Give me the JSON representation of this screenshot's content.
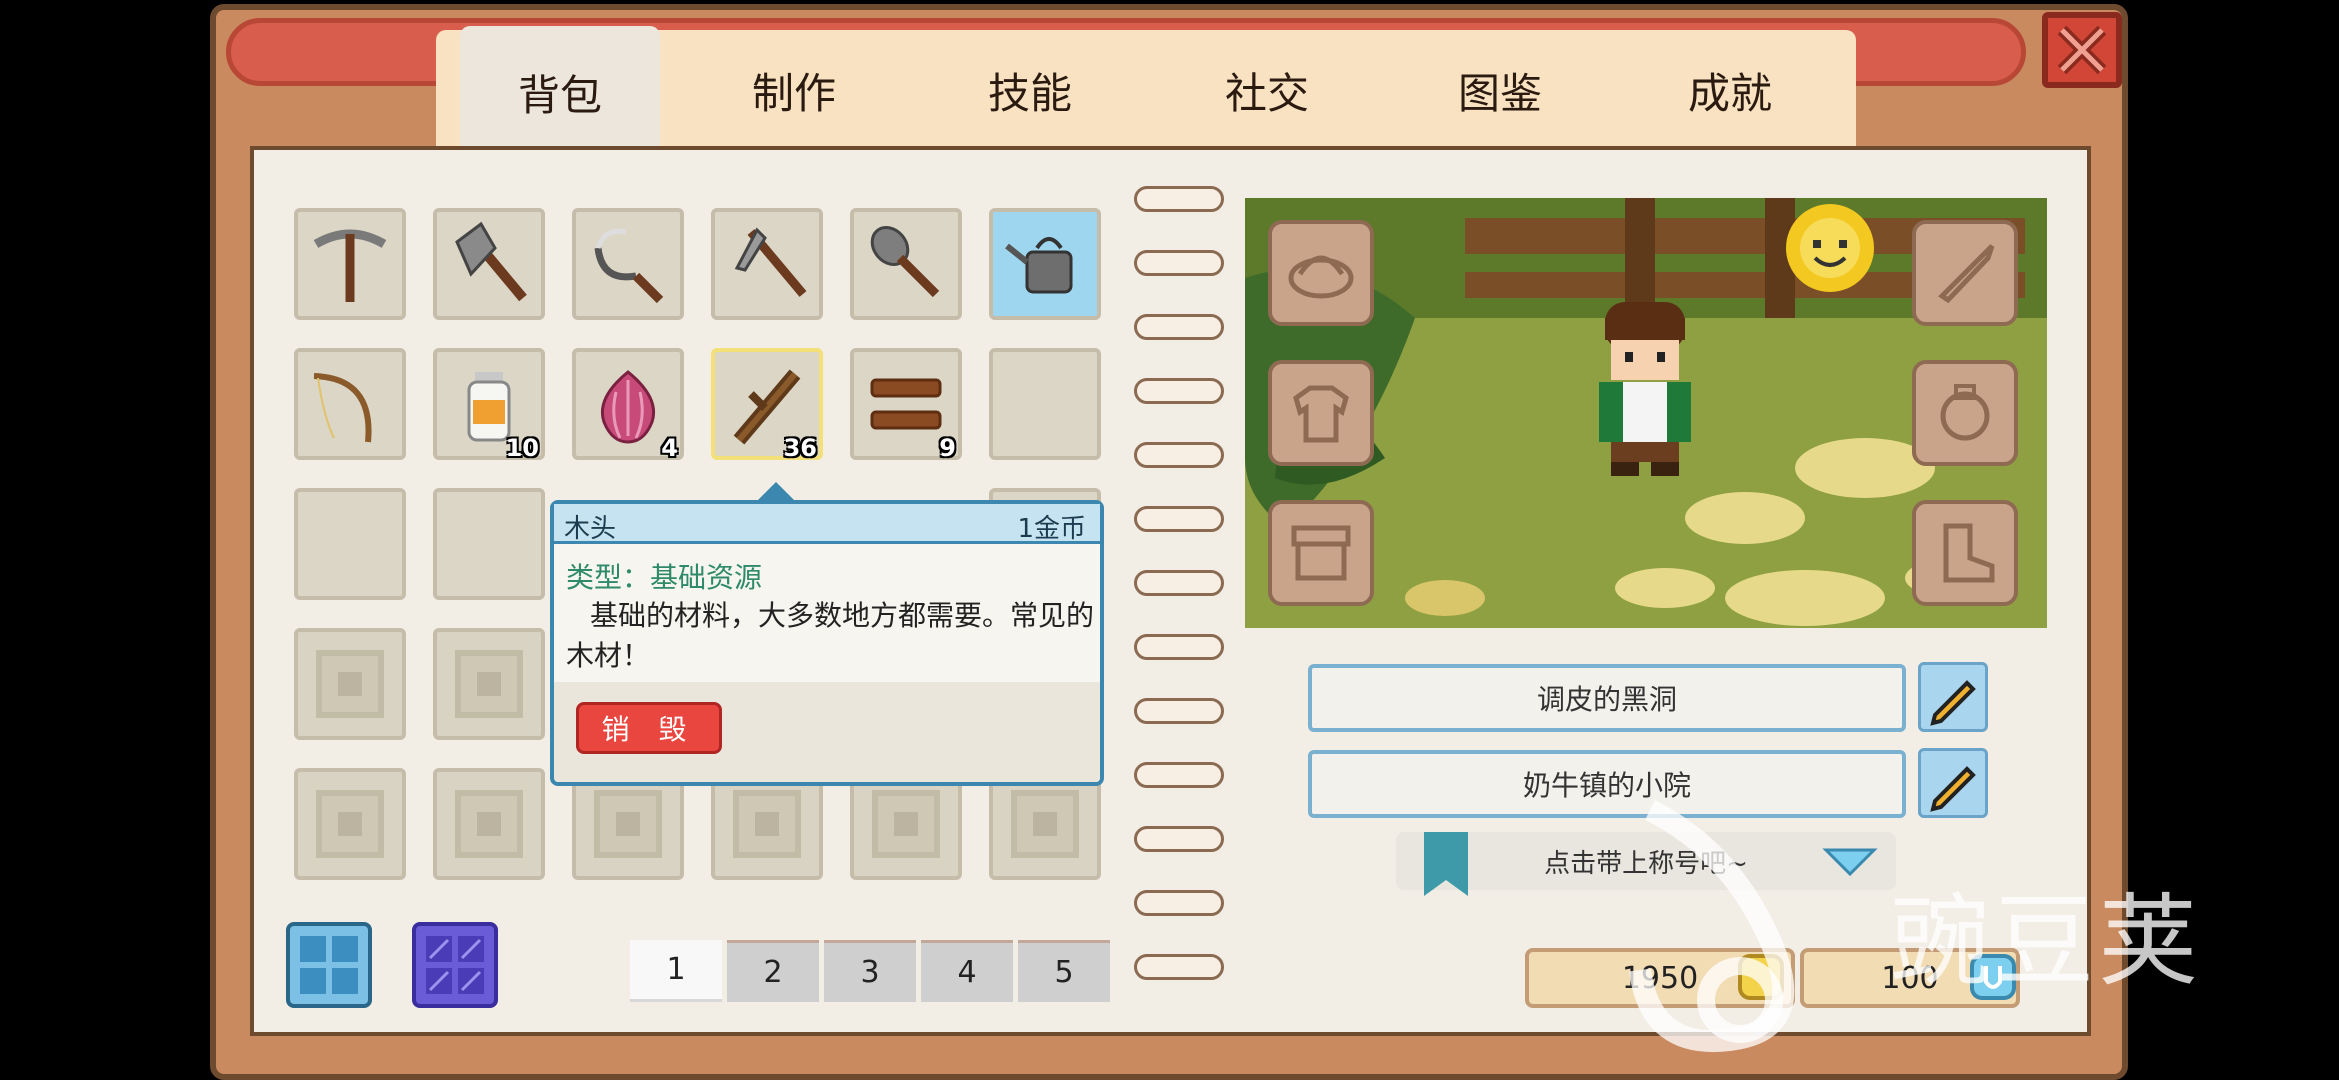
{
  "tabs": [
    "背包",
    "制作",
    "技能",
    "社交",
    "图鉴",
    "成就"
  ],
  "inventory": {
    "counts": {
      "potion": "10",
      "onion": "4",
      "wood": "36",
      "planks": "9"
    }
  },
  "tooltip": {
    "name": "木头",
    "price": "1金币",
    "type": "类型：基础资源",
    "description": "基础的材料，大多数地方都需要。常见的木材！",
    "destroy_label": "销 毁"
  },
  "pages": [
    "1",
    "2",
    "3",
    "4",
    "5"
  ],
  "character": {
    "name": "调皮的黑洞",
    "farm": "奶牛镇的小院",
    "title_placeholder": "点击带上称号吧~"
  },
  "currency": {
    "gold": "1950",
    "gems": "100"
  },
  "watermark": "豌豆荚",
  "colors": {
    "accent_red": "#d95d4c",
    "accent_blue": "#3b87b0",
    "wood_brown": "#c98a5f"
  }
}
